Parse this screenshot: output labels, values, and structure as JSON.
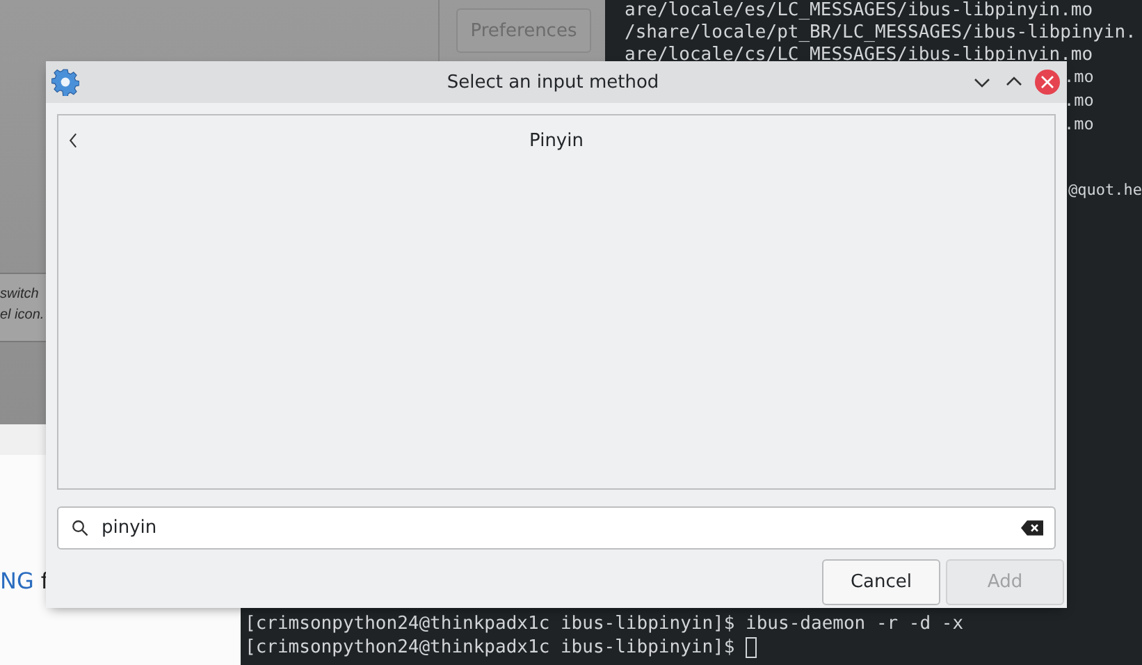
{
  "background_app": {
    "preferences_button": {
      "label": "Preferences",
      "disabled": true
    },
    "note_lines": [
      "switch",
      "el icon."
    ],
    "link_text": "NG",
    "trailing_text": "f"
  },
  "terminal": {
    "top_lines": [
      "are/locale/es/LC_MESSAGES/ibus-libpinyin.mo",
      "/share/locale/pt_BR/LC_MESSAGES/ibus-libpinyin.",
      "are/locale/cs/LC_MESSAGES/ibus-libpinyin.mo"
    ],
    "tail_lines": [
      ".mo",
      ".mo",
      ".mo",
      "@quot.he"
    ],
    "bottom_lines": [
      {
        "prompt": "[crimsonpython24@thinkpadx1c ibus-libpinyin]$",
        "command": " ibus-daemon -r -d -x",
        "cursor": false
      },
      {
        "prompt": "[crimsonpython24@thinkpadx1c ibus-libpinyin]$",
        "cursor": true
      }
    ]
  },
  "dialog": {
    "title": "Select an input method",
    "heading": "Pinyin",
    "search": {
      "value": "pinyin"
    },
    "buttons": [
      {
        "label": "Cancel",
        "disabled": false
      },
      {
        "label": "Add",
        "disabled": true
      }
    ]
  }
}
